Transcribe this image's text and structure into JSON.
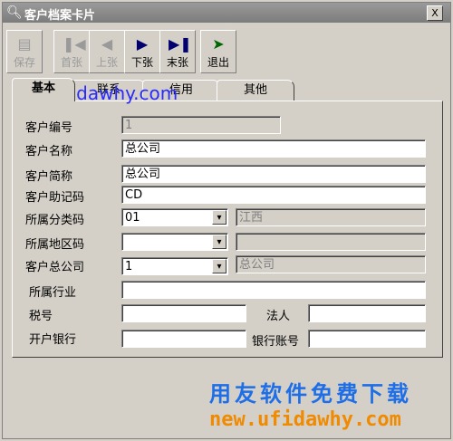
{
  "window": {
    "title": "客户档案卡片",
    "close_label": "X"
  },
  "toolbar": {
    "buttons": [
      {
        "label": "保存",
        "icon": "save-icon",
        "enabled": false
      },
      {
        "label": "首张",
        "icon": "first-icon",
        "enabled": false
      },
      {
        "label": "上张",
        "icon": "prev-icon",
        "enabled": false
      },
      {
        "label": "下张",
        "icon": "next-icon",
        "enabled": true
      },
      {
        "label": "末张",
        "icon": "last-icon",
        "enabled": true
      },
      {
        "label": "退出",
        "icon": "exit-icon",
        "enabled": true
      }
    ]
  },
  "tabs": [
    {
      "label": "基本",
      "active": true
    },
    {
      "label": "联系",
      "active": false
    },
    {
      "label": "信用",
      "active": false
    },
    {
      "label": "其他",
      "active": false
    }
  ],
  "form": {
    "customer_code": {
      "label": "客户编号",
      "value": "1"
    },
    "customer_name": {
      "label": "客户名称",
      "value": "总公司"
    },
    "customer_short": {
      "label": "客户简称",
      "value": "总公司"
    },
    "mnemonic": {
      "label": "客户助记码",
      "value": "CD"
    },
    "category": {
      "label": "所属分类码",
      "value": "01",
      "display": "江西"
    },
    "region": {
      "label": "所属地区码",
      "value": "",
      "display": ""
    },
    "head_company": {
      "label": "客户总公司",
      "value": "1",
      "display": "总公司"
    },
    "industry": {
      "label": "所属行业",
      "value": ""
    },
    "tax_no": {
      "label": "税号",
      "value": ""
    },
    "legal_person": {
      "label": "法人",
      "value": ""
    },
    "bank": {
      "label": "开户银行",
      "value": ""
    },
    "bank_account": {
      "label": "银行账号",
      "value": ""
    }
  },
  "watermarks": {
    "url_top": "new.ufidawhy.com",
    "slogan": "用友软件免费下载",
    "url_bottom": "new.ufidawhy.com"
  },
  "colors": {
    "window_bg": "#d4d0c8",
    "titlebar": "#8a8a8a",
    "watermark_blue": "#1e6ee8",
    "watermark_orange": "#f08a00"
  }
}
